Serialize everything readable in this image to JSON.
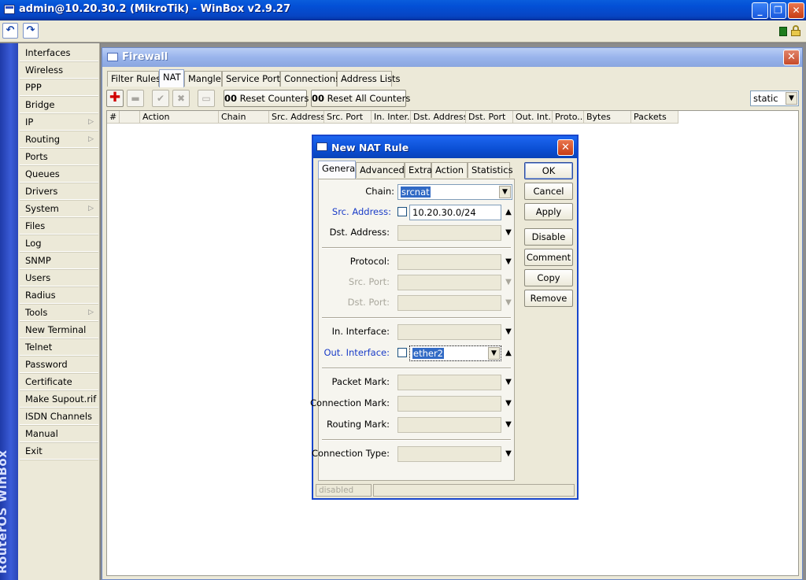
{
  "window": {
    "title": "admin@10.20.30.2 (MikroTik) - WinBox v2.9.27"
  },
  "toolbar": {
    "undo_icon": "undo-icon",
    "redo_icon": "redo-icon"
  },
  "sidebar": {
    "brand": "RouterOS WinBox",
    "items": [
      {
        "label": "Interfaces"
      },
      {
        "label": "Wireless"
      },
      {
        "label": "PPP"
      },
      {
        "label": "Bridge"
      },
      {
        "label": "IP",
        "submenu": true
      },
      {
        "label": "Routing",
        "submenu": true
      },
      {
        "label": "Ports"
      },
      {
        "label": "Queues"
      },
      {
        "label": "Drivers"
      },
      {
        "label": "System",
        "submenu": true
      },
      {
        "label": "Files"
      },
      {
        "label": "Log"
      },
      {
        "label": "SNMP"
      },
      {
        "label": "Users"
      },
      {
        "label": "Radius"
      },
      {
        "label": "Tools",
        "submenu": true
      },
      {
        "label": "New Terminal"
      },
      {
        "label": "Telnet"
      },
      {
        "label": "Password"
      },
      {
        "label": "Certificate"
      },
      {
        "label": "Make Supout.rif"
      },
      {
        "label": "ISDN Channels"
      },
      {
        "label": "Manual"
      },
      {
        "label": "Exit"
      }
    ]
  },
  "firewall": {
    "title": "Firewall",
    "tabs": [
      "Filter Rules",
      "NAT",
      "Mangle",
      "Service Ports",
      "Connections",
      "Address Lists"
    ],
    "active_tab": "NAT",
    "reset_counters": "Reset Counters",
    "reset_all_counters": "Reset All Counters",
    "counter_icon": "00",
    "filter_value": "static",
    "columns": [
      "#",
      "",
      "Action",
      "Chain",
      "Src. Address",
      "Src. Port",
      "In. Inter...",
      "Dst. Address",
      "Dst. Port",
      "Out. Int...",
      "Proto...",
      "Bytes",
      "Packets"
    ]
  },
  "dialog": {
    "title": "New NAT Rule",
    "tabs": [
      "General",
      "Advanced",
      "Extra",
      "Action",
      "Statistics"
    ],
    "active_tab": "General",
    "fields": {
      "chain": {
        "label": "Chain:",
        "value": "srcnat"
      },
      "src_address": {
        "label": "Src. Address:",
        "value": "10.20.30.0/24"
      },
      "dst_address": {
        "label": "Dst. Address:"
      },
      "protocol": {
        "label": "Protocol:"
      },
      "src_port": {
        "label": "Src. Port:"
      },
      "dst_port": {
        "label": "Dst. Port:"
      },
      "in_interface": {
        "label": "In. Interface:"
      },
      "out_interface": {
        "label": "Out. Interface:",
        "value": "ether2"
      },
      "packet_mark": {
        "label": "Packet Mark:"
      },
      "connection_mark": {
        "label": "Connection Mark:"
      },
      "routing_mark": {
        "label": "Routing Mark:"
      },
      "connection_type": {
        "label": "Connection Type:"
      }
    },
    "buttons": [
      "OK",
      "Cancel",
      "Apply",
      "Disable",
      "Comment",
      "Copy",
      "Remove"
    ],
    "status": "disabled"
  }
}
